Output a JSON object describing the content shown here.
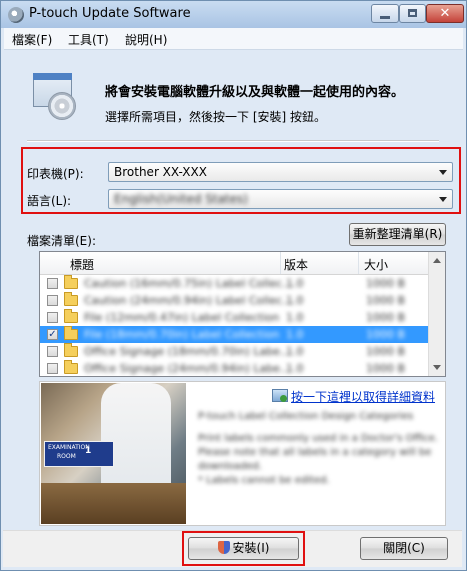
{
  "window": {
    "title": "P-touch Update Software"
  },
  "menu": [
    "檔案(F)",
    "工具(T)",
    "說明(H)"
  ],
  "header": {
    "heading": "將會安裝電腦軟體升級以及與軟體一起使用的內容。",
    "instruction": "選擇所需項目，然後按一下 [安裝] 按鈕。"
  },
  "printer": {
    "label": "印表機(P):",
    "value": "Brother XX-XXX"
  },
  "language": {
    "label": "語言(L):",
    "value": "English(United States)"
  },
  "file_list": {
    "label": "檔案清單(E):",
    "refresh_button": "重新整理清單(R)",
    "columns": [
      "標題",
      "版本",
      "大小"
    ],
    "rows": [
      {
        "title": "Caution (16mm/0.75in) Label Collec...",
        "version": "1.0",
        "size": "1000 B",
        "checked": false,
        "selected": false
      },
      {
        "title": "Caution (24mm/0.94in) Label Collec...",
        "version": "1.0",
        "size": "1000 B",
        "checked": false,
        "selected": false
      },
      {
        "title": "File (12mm/0.47in) Label Collection",
        "version": "1.0",
        "size": "1000 B",
        "checked": false,
        "selected": false
      },
      {
        "title": "File (18mm/0.70in) Label Collection",
        "version": "1.0",
        "size": "1000 B",
        "checked": true,
        "selected": true
      },
      {
        "title": "Office Signage (18mm/0.70in) Labe...",
        "version": "1.0",
        "size": "1000 B",
        "checked": false,
        "selected": false
      },
      {
        "title": "Office Signage (24mm/0.94in) Labe...",
        "version": "1.0",
        "size": "1000 B",
        "checked": false,
        "selected": false
      }
    ]
  },
  "preview": {
    "link": "按一下這裡以取得詳細資料",
    "collection_title": "P-touch Label Collection Design Categories",
    "description_lines": [
      "Print labels commonly used in a Doctor's Office.",
      "Please note that all labels in a category will be",
      "downloaded.",
      "* Labels cannot be edited."
    ],
    "sign_text": [
      "EXAMINATION",
      "ROOM"
    ],
    "sign_number": "1"
  },
  "buttons": {
    "install": "安裝(I)",
    "close": "關閉(C)"
  },
  "colors": {
    "highlight_red": "#e01010",
    "selection_blue": "#3399ff",
    "link_blue": "#0033cc"
  }
}
